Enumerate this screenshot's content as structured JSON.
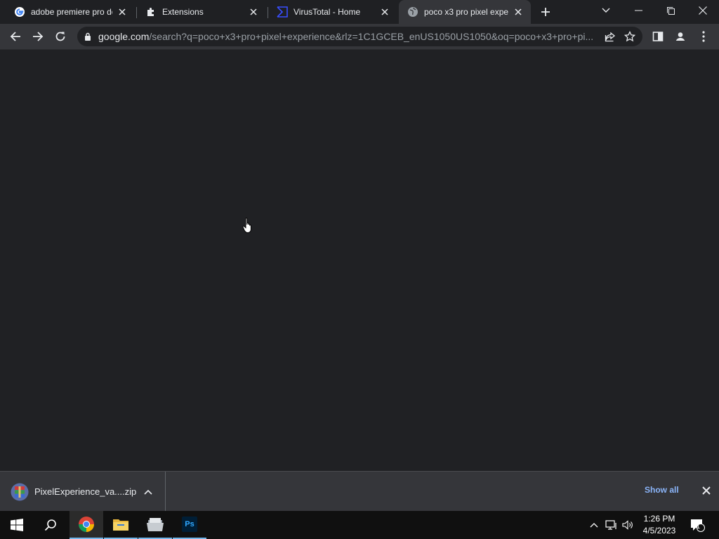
{
  "tabs": [
    {
      "title": "adobe premiere pro do",
      "icon": "google-icon",
      "active": false
    },
    {
      "title": "Extensions",
      "icon": "puzzle-icon",
      "active": false
    },
    {
      "title": "VirusTotal - Home",
      "icon": "virustotal-icon",
      "active": false
    },
    {
      "title": "poco x3 pro pixel expe",
      "icon": "globe-icon",
      "active": true
    }
  ],
  "omnibox": {
    "host": "google.com",
    "path": "/search?q=poco+x3+pro+pixel+experience&rlz=1C1GCEB_enUS1050US1050&oq=poco+x3+pro+pi..."
  },
  "downloads": {
    "file_name": "PixelExperience_va....zip",
    "show_all_label": "Show all"
  },
  "taskbar": {
    "apps": [
      "start-icon",
      "search-icon",
      "chrome-icon",
      "file-explorer-icon",
      "folder-app-icon",
      "photoshop-icon"
    ],
    "photoshop_label": "Ps"
  },
  "clock": {
    "time": "1:26 PM",
    "date": "4/5/2023"
  },
  "notifications": {
    "count": "1"
  },
  "colors": {
    "background": "#202124",
    "toolbar": "#35363a",
    "accent_link": "#8ab4f8",
    "taskbar": "#101010"
  }
}
